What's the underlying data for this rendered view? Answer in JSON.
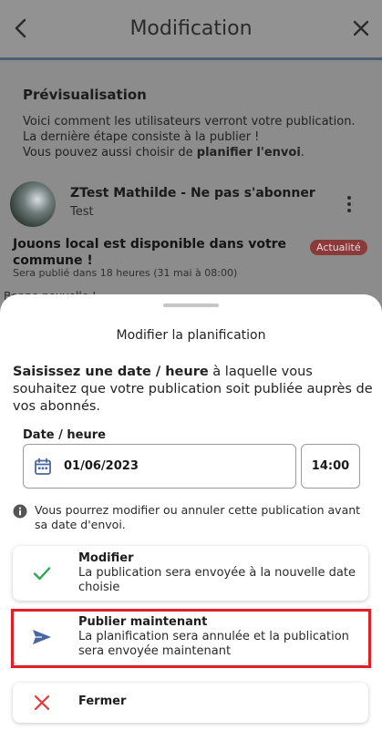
{
  "header": {
    "title": "Modification"
  },
  "preview": {
    "heading": "Prévisualisation",
    "line1": "Voici comment les utilisateurs verront votre publication.",
    "line2": "La dernière étape consiste à la publier !",
    "line3_prefix": "Vous pouvez aussi choisir de ",
    "line3_bold": "planifier l'envoi",
    "line3_suffix": "."
  },
  "post": {
    "author": "ZTest Mathilde - Ne pas s'abonner",
    "subtitle": "Test",
    "title": "Jouons local est disponible dans votre commune !",
    "badge": "Actualité",
    "meta": "Sera publié dans 18 heures (31 mai à 08:00)",
    "peek": "Bonne nouvelle !"
  },
  "sheet": {
    "title": "Modifier la planification",
    "intro_bold": "Saisissez une date / heure",
    "intro_rest": " à laquelle vous souhaitez que votre publication soit publiée auprès de vos abonnés.",
    "field_label": "Date / heure",
    "date_value": "01/06/2023",
    "time_value": "14:00",
    "info": "Vous pourrez modifier ou annuler cette publication avant sa date d'envoi.",
    "actions": [
      {
        "title": "Modifier",
        "desc": "La publication sera envoyée à la nouvelle date choisie",
        "icon": "check-icon"
      },
      {
        "title": "Publier maintenant",
        "desc": "La planification sera annulée et la publication sera envoyée maintenant",
        "icon": "send-icon"
      },
      {
        "title": "Fermer",
        "desc": "",
        "icon": "close-icon"
      }
    ]
  },
  "colors": {
    "accent": "#4a67a0",
    "check": "#2fa84f",
    "close": "#e53935",
    "highlight": "#e21f26",
    "badge": "#8b3a3a"
  }
}
